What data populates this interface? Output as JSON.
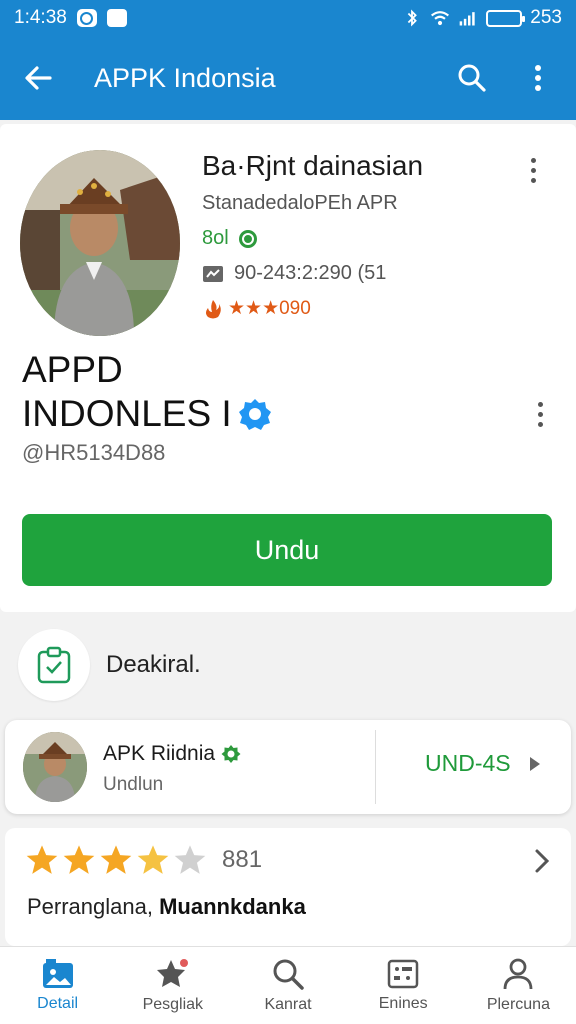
{
  "status_bar": {
    "time": "1:4:38",
    "battery_level": "253"
  },
  "app_bar": {
    "title": "APPK Indonsia"
  },
  "app": {
    "name": "Ba·Rjnt dainasian",
    "subtitle": "StanadedaloPEh APR",
    "version": "8ol",
    "id_text": "90-243:2:290 (51",
    "rating_text": "★★★090",
    "big_title_line1": "APPD",
    "big_title_line2": "INDONLES I",
    "handle": "@HR5134D88",
    "download_label": "Undu"
  },
  "description": {
    "label": "Deakiral."
  },
  "related_app": {
    "name": "APK Riidnia",
    "subtitle": "Undlun",
    "action_label": "UND-4S"
  },
  "rating": {
    "stars_filled": 4,
    "stars_total": 5,
    "count": "881",
    "text_normal": "Perranglana,",
    "text_bold": "Muannkdanka"
  },
  "bottom_nav": {
    "items": [
      {
        "label": "Detail",
        "icon": "detail-icon",
        "active": true
      },
      {
        "label": "Pesgliak",
        "icon": "star-icon",
        "active": false
      },
      {
        "label": "Kanrat",
        "icon": "search-icon",
        "active": false
      },
      {
        "label": "Enines",
        "icon": "grid-icon",
        "active": false
      },
      {
        "label": "Plercuna",
        "icon": "person-icon",
        "active": false
      }
    ]
  },
  "colors": {
    "primary": "#1a86cf",
    "download_green": "#1fa33d",
    "verified_blue": "#2196f3",
    "rating_orange": "#e05a16",
    "star_gold": "#f5a623"
  }
}
